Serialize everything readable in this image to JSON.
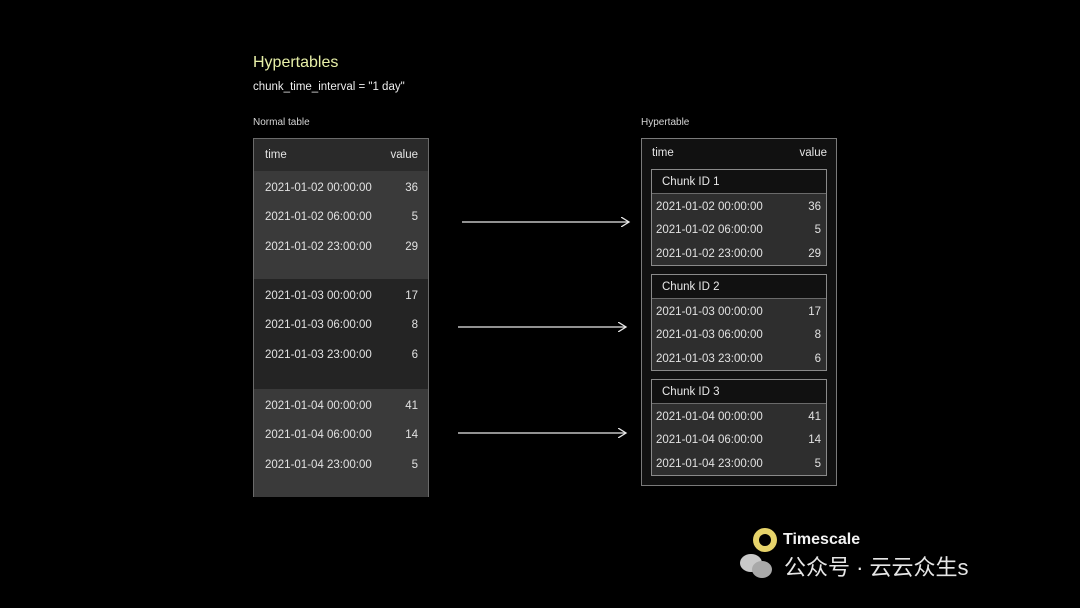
{
  "title": "Hypertables",
  "subtitle": "chunk_time_interval = \"1 day\"",
  "normal_table": {
    "caption": "Normal table",
    "columns": [
      "time",
      "value"
    ],
    "groups": [
      [
        [
          "2021-01-02 00:00:00",
          "36"
        ],
        [
          "2021-01-02 06:00:00",
          "5"
        ],
        [
          "2021-01-02 23:00:00",
          "29"
        ]
      ],
      [
        [
          "2021-01-03 00:00:00",
          "17"
        ],
        [
          "2021-01-03 06:00:00",
          "8"
        ],
        [
          "2021-01-03 23:00:00",
          "6"
        ]
      ],
      [
        [
          "2021-01-04 00:00:00",
          "41"
        ],
        [
          "2021-01-04 06:00:00",
          "14"
        ],
        [
          "2021-01-04 23:00:00",
          "5"
        ]
      ]
    ]
  },
  "hypertable": {
    "caption": "Hypertable",
    "columns": [
      "time",
      "value"
    ],
    "chunks": [
      {
        "label": "Chunk ID 1",
        "rows": [
          [
            "2021-01-02 00:00:00",
            "36"
          ],
          [
            "2021-01-02 06:00:00",
            "5"
          ],
          [
            "2021-01-02 23:00:00",
            "29"
          ]
        ]
      },
      {
        "label": "Chunk ID 2",
        "rows": [
          [
            "2021-01-03 00:00:00",
            "17"
          ],
          [
            "2021-01-03 06:00:00",
            "8"
          ],
          [
            "2021-01-03 23:00:00",
            "6"
          ]
        ]
      },
      {
        "label": "Chunk ID 3",
        "rows": [
          [
            "2021-01-04 00:00:00",
            "41"
          ],
          [
            "2021-01-04 06:00:00",
            "14"
          ],
          [
            "2021-01-04 23:00:00",
            "5"
          ]
        ]
      }
    ]
  },
  "logo": {
    "name": "Timescale",
    "icon": "timescale-logo-icon"
  },
  "watermark": {
    "text": "公众号 · 云云众生s",
    "icon": "wechat-icon"
  },
  "colors": {
    "title": "#e8f0a8",
    "background": "#000000",
    "logo": "#e6d36a"
  }
}
